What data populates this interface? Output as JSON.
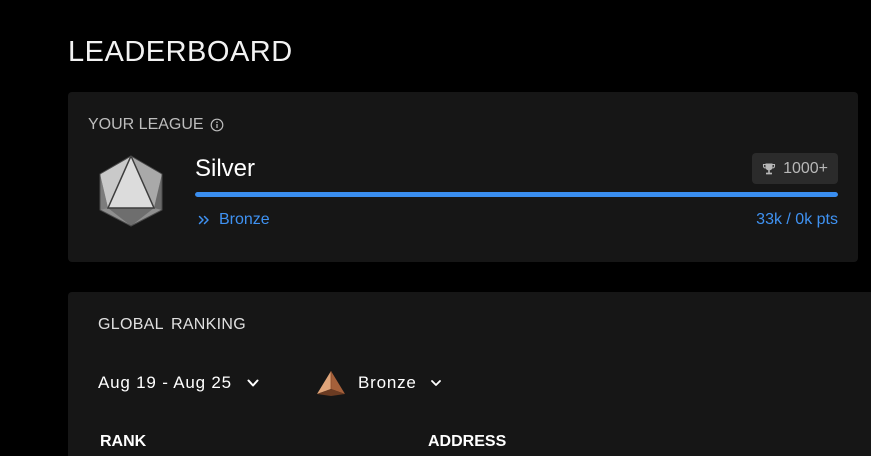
{
  "page": {
    "title": "LEADERBOARD"
  },
  "league": {
    "label": "YOUR LEAGUE",
    "info_icon": "info-icon",
    "current": "Silver",
    "emblem_icon": "silver-icosahedron-icon",
    "rank_badge": "1000+",
    "rank_badge_icon": "trophy-icon",
    "progress": 1.0,
    "next_league": "Bronze",
    "next_league_icon": "double-chevron-right-icon",
    "points": "33k / 0k pts",
    "accent_color": "#3a8ef0"
  },
  "ranking": {
    "title": "GLOBAL  RANKING",
    "date_range": "Aug 19 - Aug 25",
    "league_filter": "Bronze",
    "league_filter_icon": "bronze-pyramid-icon",
    "columns": [
      "RANK",
      "ADDRESS"
    ]
  }
}
